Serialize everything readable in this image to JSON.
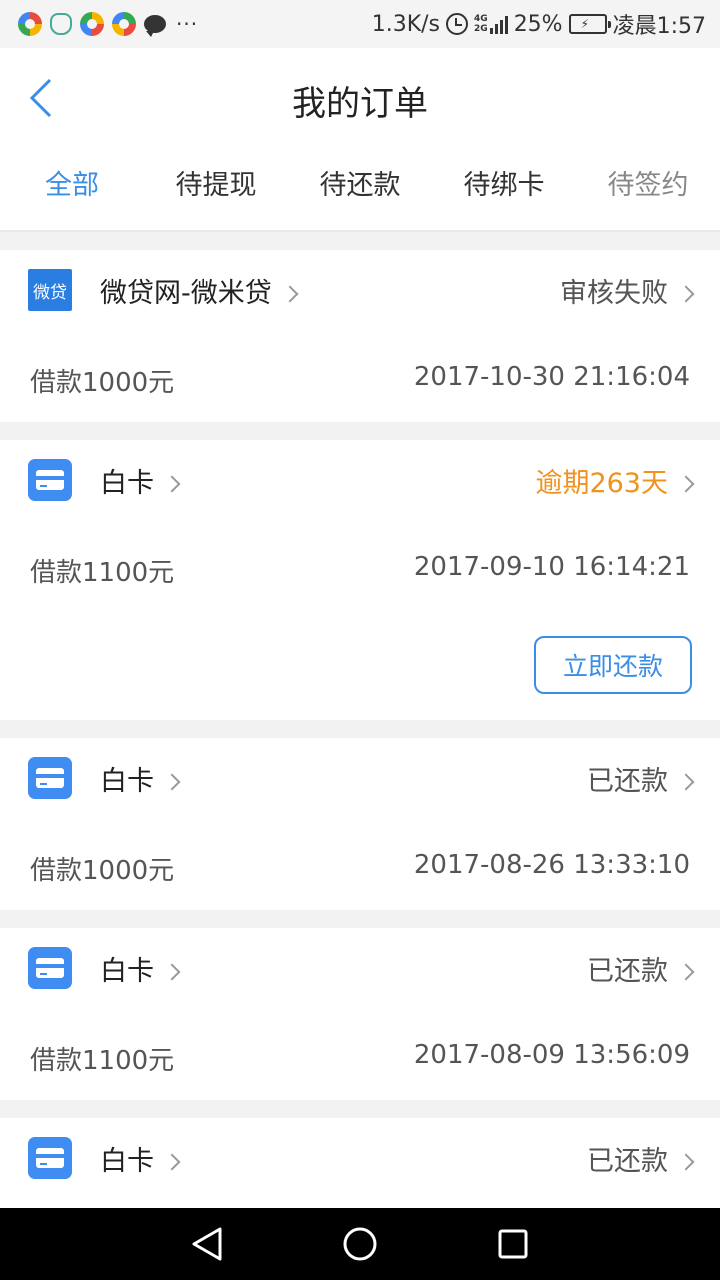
{
  "status_bar": {
    "speed": "1.3K/s",
    "network": "4G",
    "network2": "2G",
    "battery": "25%",
    "time": "凌晨1:57"
  },
  "header": {
    "title": "我的订单"
  },
  "tabs": [
    {
      "label": "全部"
    },
    {
      "label": "待提现"
    },
    {
      "label": "待还款"
    },
    {
      "label": "待绑卡"
    },
    {
      "label": "待签约"
    }
  ],
  "orders": [
    {
      "logo_text": "微贷",
      "lender": "微贷网-微米贷",
      "status": "审核失败",
      "amount": "借款1000元",
      "datetime": "2017-10-30 21:16:04"
    },
    {
      "lender": "白卡",
      "status": "逾期263天",
      "amount": "借款1100元",
      "datetime": "2017-09-10 16:14:21",
      "action": "立即还款"
    },
    {
      "lender": "白卡",
      "status": "已还款",
      "amount": "借款1000元",
      "datetime": "2017-08-26 13:33:10"
    },
    {
      "lender": "白卡",
      "status": "已还款",
      "amount": "借款1100元",
      "datetime": "2017-08-09 13:56:09"
    },
    {
      "lender": "白卡",
      "status": "已还款"
    }
  ],
  "colors": {
    "accent": "#3a8ee6",
    "overdue": "#f0921e"
  }
}
